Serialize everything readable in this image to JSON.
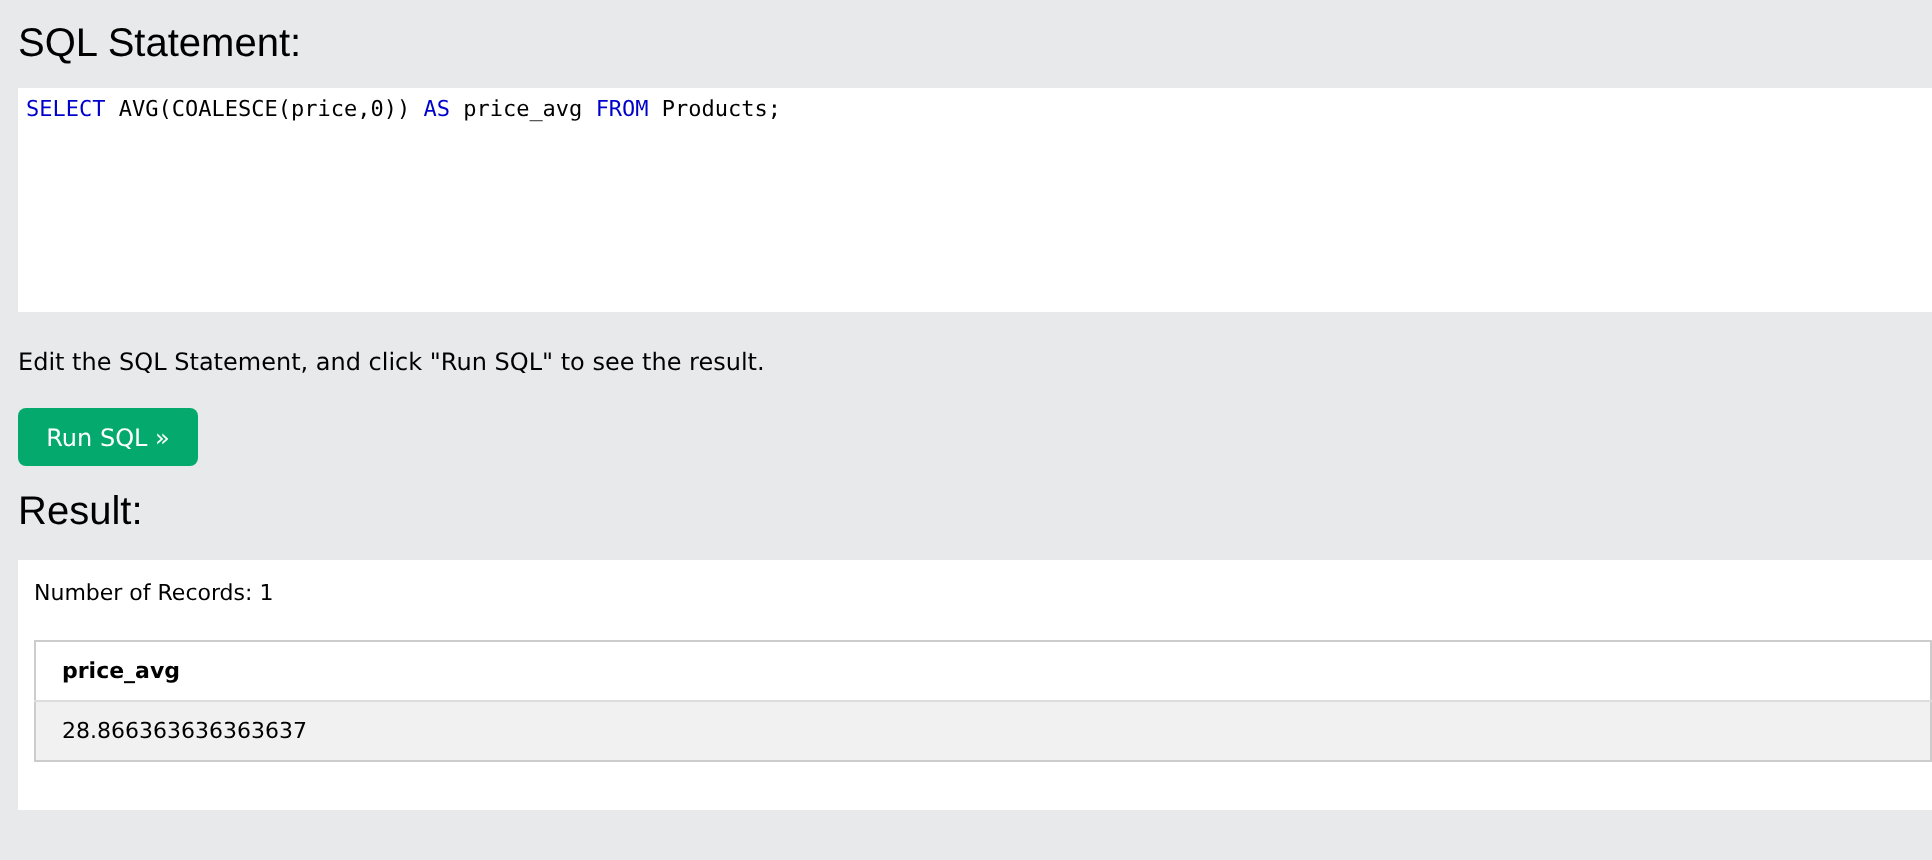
{
  "sql_heading": "SQL Statement:",
  "editor": {
    "tokens": [
      {
        "kind": "keyword",
        "text": "SELECT"
      },
      {
        "kind": "plain",
        "text": " AVG(COALESCE(price,0)) "
      },
      {
        "kind": "keyword",
        "text": "AS"
      },
      {
        "kind": "plain",
        "text": " price_avg "
      },
      {
        "kind": "keyword",
        "text": "FROM"
      },
      {
        "kind": "plain",
        "text": " Products;"
      }
    ]
  },
  "instruction": "Edit the SQL Statement, and click \"Run SQL\" to see the result.",
  "run_button": "Run SQL »",
  "result_heading": "Result:",
  "record_count": "Number of Records: 1",
  "table": {
    "columns": [
      "price_avg"
    ],
    "rows": [
      [
        "28.866363636363637"
      ]
    ]
  }
}
